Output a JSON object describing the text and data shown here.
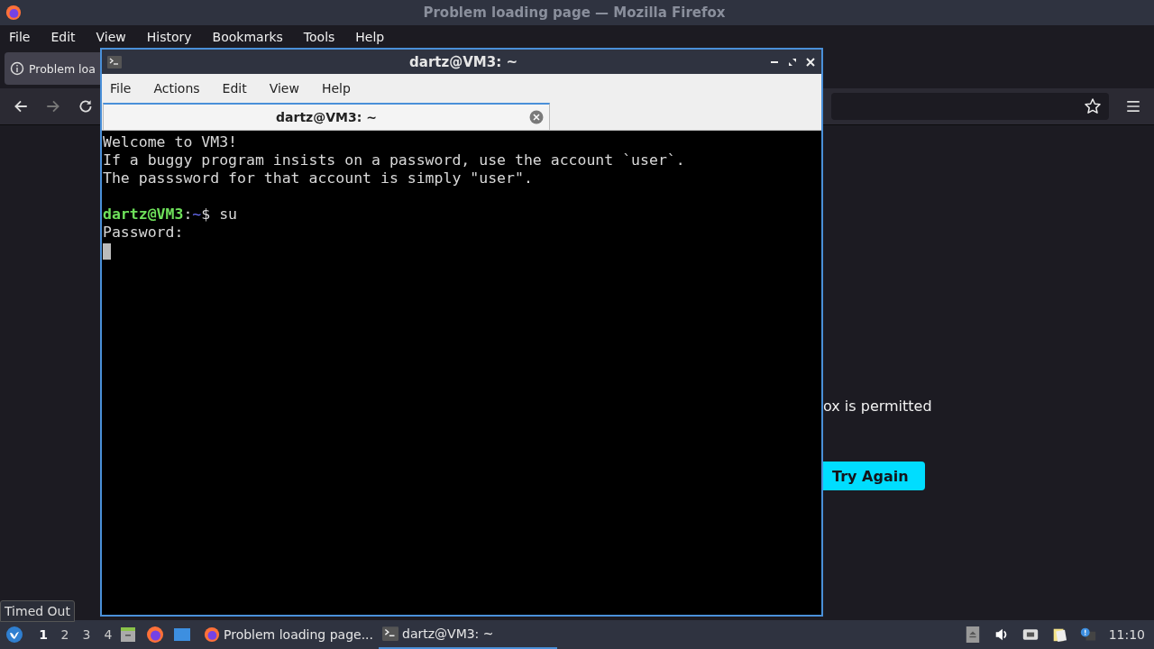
{
  "firefox": {
    "title": "Problem loading page — Mozilla Firefox",
    "menu": [
      "File",
      "Edit",
      "View",
      "History",
      "Bookmarks",
      "Tools",
      "Help"
    ],
    "tabs": [
      {
        "label": "Problem loa",
        "selected": true
      }
    ],
    "message": "ox is permitted",
    "retry_button": "Try Again"
  },
  "terminal": {
    "title": "dartz@VM3: ~",
    "menu": [
      "File",
      "Actions",
      "Edit",
      "View",
      "Help"
    ],
    "tabs": [
      {
        "label": "dartz@VM3: ~",
        "selected": true
      }
    ],
    "lines": [
      {
        "kind": "text",
        "text": "Welcome to VM3!"
      },
      {
        "kind": "text",
        "text": "If a buggy program insists on a password, use the account `user`."
      },
      {
        "kind": "text",
        "text": "The passsword for that account is simply \"user\"."
      },
      {
        "kind": "blank"
      },
      {
        "kind": "prompt",
        "user_host": "dartz@VM3",
        "separator": ":",
        "path": "~",
        "command": "$ su"
      },
      {
        "kind": "text",
        "text": "Password:"
      },
      {
        "kind": "cursor"
      }
    ]
  },
  "tooltip": "Timed Out",
  "taskbar": {
    "workspaces": [
      {
        "label": "1",
        "selected": true
      },
      {
        "label": "2",
        "selected": false
      },
      {
        "label": "3",
        "selected": false
      },
      {
        "label": "4",
        "selected": false
      }
    ],
    "tasks": [
      {
        "kind": "browser",
        "label": "Problem loading page...",
        "selected": false
      },
      {
        "kind": "terminal",
        "label": "dartz@VM3: ~",
        "selected": true
      }
    ],
    "clock": "11:10"
  }
}
